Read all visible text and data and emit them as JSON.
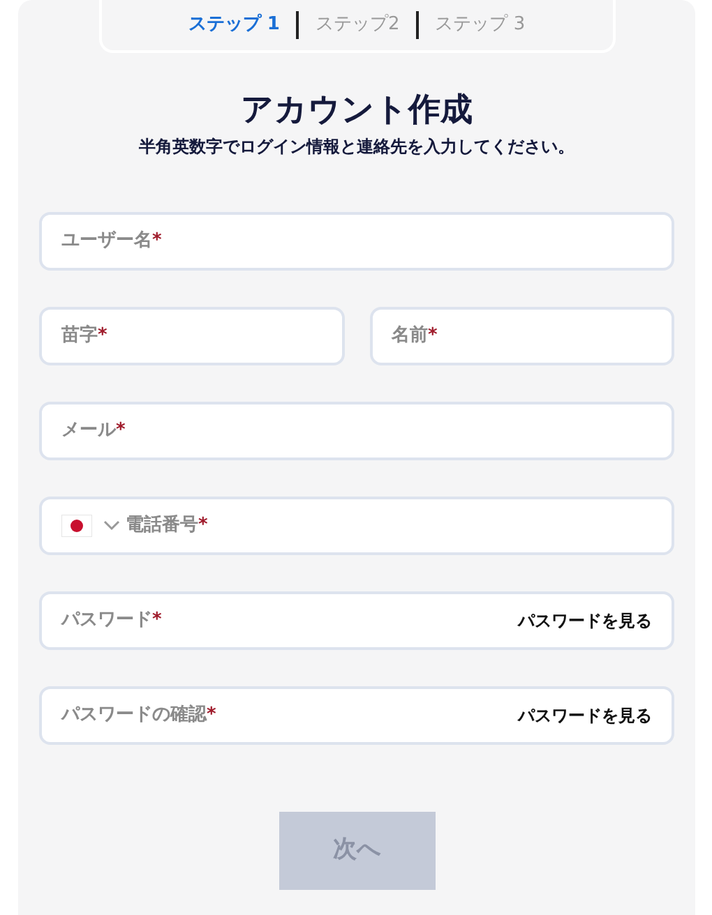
{
  "steps": [
    {
      "label": "ステップ 1",
      "selected": true
    },
    {
      "label": "ステップ2",
      "selected": false
    },
    {
      "label": "ステップ 3",
      "selected": false
    }
  ],
  "title": "アカウント作成",
  "subtitle": "半角英数字でログイン情報と連絡先を入力してください。",
  "required_mark": "*",
  "rows": [
    [
      {
        "kind": "text",
        "placeholder": "ユーザー名"
      }
    ],
    [
      {
        "kind": "text",
        "placeholder": "苗字"
      },
      {
        "kind": "text",
        "placeholder": "名前"
      }
    ],
    [
      {
        "kind": "text",
        "placeholder": "メール"
      }
    ],
    [
      {
        "kind": "phone",
        "placeholder": "電話番号"
      }
    ],
    [
      {
        "kind": "password",
        "placeholder": "パスワード",
        "toggle": "パスワードを見る"
      }
    ],
    [
      {
        "kind": "password",
        "placeholder": "パスワードの確認",
        "toggle": "パスワードを見る"
      }
    ]
  ],
  "next_button": {
    "label": "次へ",
    "disabled": true
  }
}
